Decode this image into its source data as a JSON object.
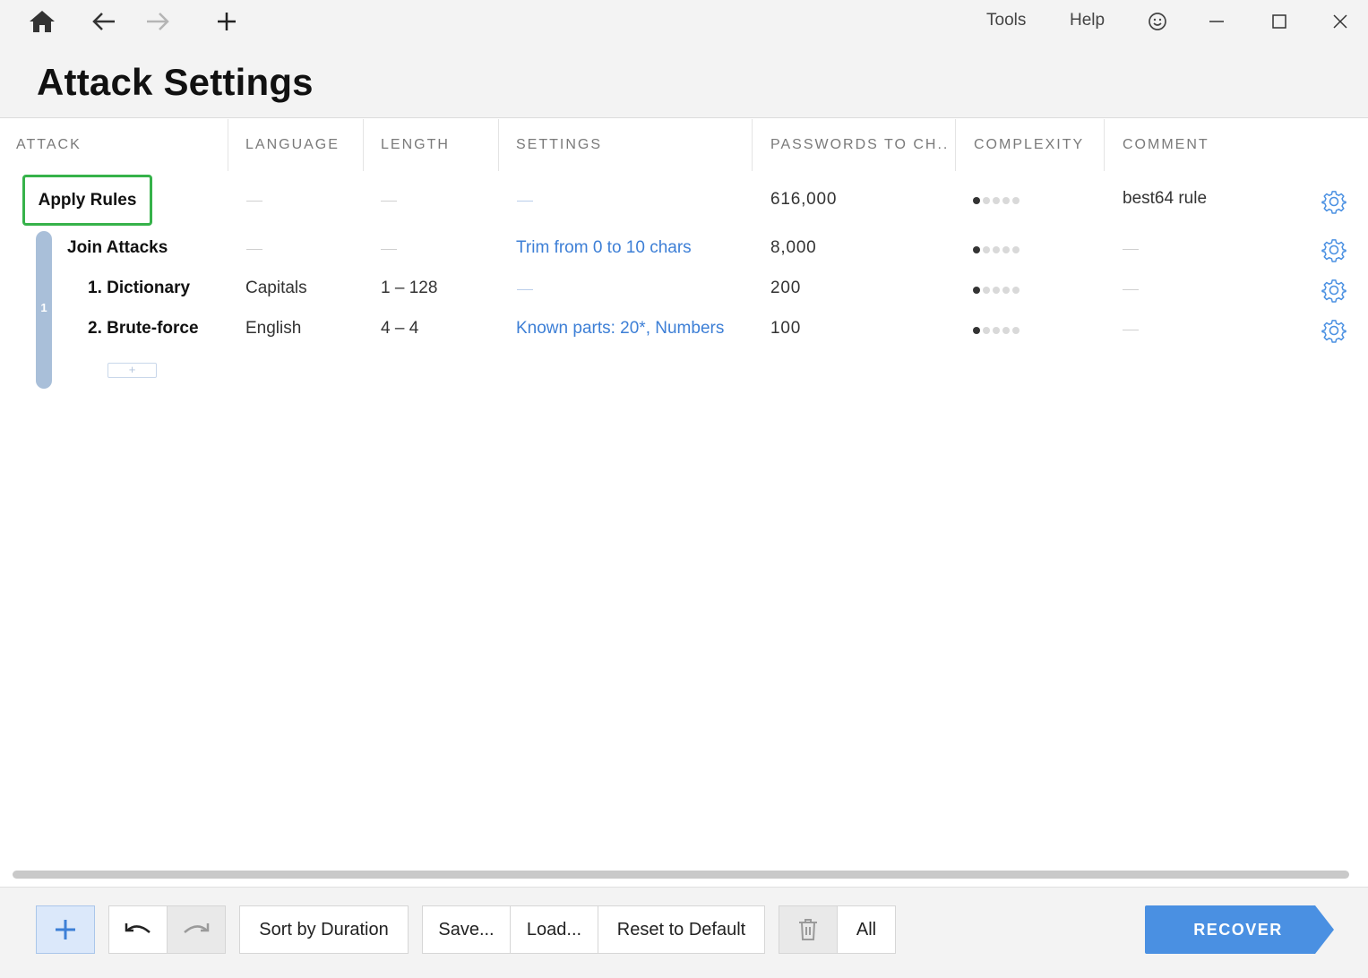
{
  "window": {
    "menu_tools": "Tools",
    "menu_help": "Help"
  },
  "page": {
    "title": "Attack Settings"
  },
  "columns": [
    "ATTACK",
    "LANGUAGE",
    "LENGTH",
    "SETTINGS",
    "PASSWORDS TO CH...",
    "COMPLEXITY",
    "COMMENT"
  ],
  "rows": [
    {
      "attack": "Apply Rules",
      "language": "",
      "length": "",
      "settings": "",
      "passwords": "616,000",
      "complexity": 1,
      "comment": "best64 rule"
    },
    {
      "attack": "Join Attacks",
      "language": "",
      "length": "",
      "settings": "Trim from 0 to 10 chars",
      "passwords": "8,000",
      "complexity": 1,
      "comment": ""
    },
    {
      "attack": "1. Dictionary",
      "language": "Capitals",
      "length": "1 – 128",
      "settings": "",
      "passwords": "200",
      "complexity": 1,
      "comment": ""
    },
    {
      "attack": "2. Brute-force",
      "language": "English",
      "length": "4 – 4",
      "settings": "Known parts: 20*, Numbers",
      "passwords": "100",
      "complexity": 1,
      "comment": ""
    }
  ],
  "group": {
    "number": "1",
    "add_label": "+"
  },
  "toolbar": {
    "add_label": "+",
    "sort_label": "Sort by Duration",
    "save_label": "Save...",
    "load_label": "Load...",
    "reset_label": "Reset to Default",
    "all_label": "All",
    "recover_label": "RECOVER"
  },
  "colors": {
    "accent": "#4a90e2",
    "highlight": "#36b24a",
    "link": "#3d7fd6"
  }
}
